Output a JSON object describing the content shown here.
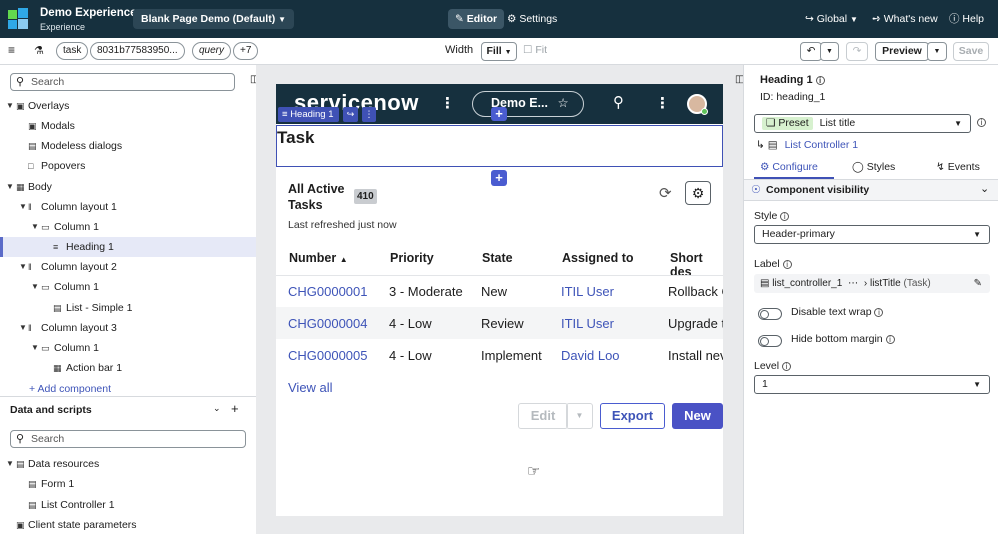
{
  "topbar": {
    "app_title": "Demo Experience",
    "app_subtitle": "Experience",
    "page_selector": "Blank Page Demo (Default)",
    "editor_label": "Editor",
    "settings_label": "Settings",
    "global_label": "Global",
    "whats_new_label": "What's new",
    "help_label": "Help"
  },
  "toolbar": {
    "chips": [
      "task",
      "8031b77583950...",
      "query",
      "+7"
    ],
    "width_label": "Width",
    "width_value": "Fill",
    "fit_label": "Fit",
    "preview_label": "Preview",
    "save_label": "Save"
  },
  "left_panel": {
    "search_placeholder": "Search",
    "tree": [
      {
        "label": "Overlays"
      },
      {
        "label": "Modals"
      },
      {
        "label": "Modeless dialogs"
      },
      {
        "label": "Popovers"
      },
      {
        "label": "Body"
      },
      {
        "label": "Column layout 1"
      },
      {
        "label": "Column 1"
      },
      {
        "label": "Heading 1"
      },
      {
        "label": "Column layout 2"
      },
      {
        "label": "Column 1"
      },
      {
        "label": "List - Simple 1"
      },
      {
        "label": "Column layout 3"
      },
      {
        "label": "Column 1"
      },
      {
        "label": "Action bar 1"
      }
    ],
    "add_component": "+ Add component",
    "data_scripts_title": "Data and scripts",
    "data_search_placeholder": "Search",
    "data_tree": [
      {
        "label": "Data resources"
      },
      {
        "label": "Form 1"
      },
      {
        "label": "List Controller 1"
      },
      {
        "label": "Client state parameters"
      }
    ]
  },
  "canvas": {
    "brand": "servicenow",
    "header_pill": "Demo E...",
    "heading_tag": "Heading 1",
    "heading_text": "Task",
    "list_title_line1": "All Active",
    "list_title_line2": "Tasks",
    "count_badge": "410",
    "refreshed": "Last refreshed just now",
    "columns": [
      "Number",
      "Priority",
      "State",
      "Assigned to",
      "Short des"
    ],
    "rows": [
      {
        "number": "CHG0000001",
        "priority": "3 - Moderate",
        "state": "New",
        "assigned": "ITIL User",
        "short": "Rollback C"
      },
      {
        "number": "CHG0000004",
        "priority": "4 - Low",
        "state": "Review",
        "assigned": "ITIL User",
        "short": "Upgrade t"
      },
      {
        "number": "CHG0000005",
        "priority": "4 - Low",
        "state": "Implement",
        "assigned": "David Loo",
        "short": "Install nev"
      }
    ],
    "view_all": "View all",
    "edit_label": "Edit",
    "export_label": "Export",
    "new_label": "New"
  },
  "right_panel": {
    "title": "Heading 1",
    "id_label": "ID: heading_1",
    "preset_label": "Preset",
    "preset_value": "List title",
    "controller_link": "List Controller 1",
    "tabs": [
      "Configure",
      "Styles",
      "Events"
    ],
    "section_title": "Component visibility",
    "style_label": "Style",
    "style_value": "Header-primary",
    "label_label": "Label",
    "label_value_a": "list_controller_1",
    "label_value_b": "listTitle",
    "label_value_c": "(Task)",
    "disable_wrap": "Disable text wrap",
    "hide_margin": "Hide bottom margin",
    "level_label": "Level",
    "level_value": "1"
  },
  "colors": {
    "topbar": "#16303e",
    "accent": "#3f51b5",
    "link": "#3e54b8"
  }
}
